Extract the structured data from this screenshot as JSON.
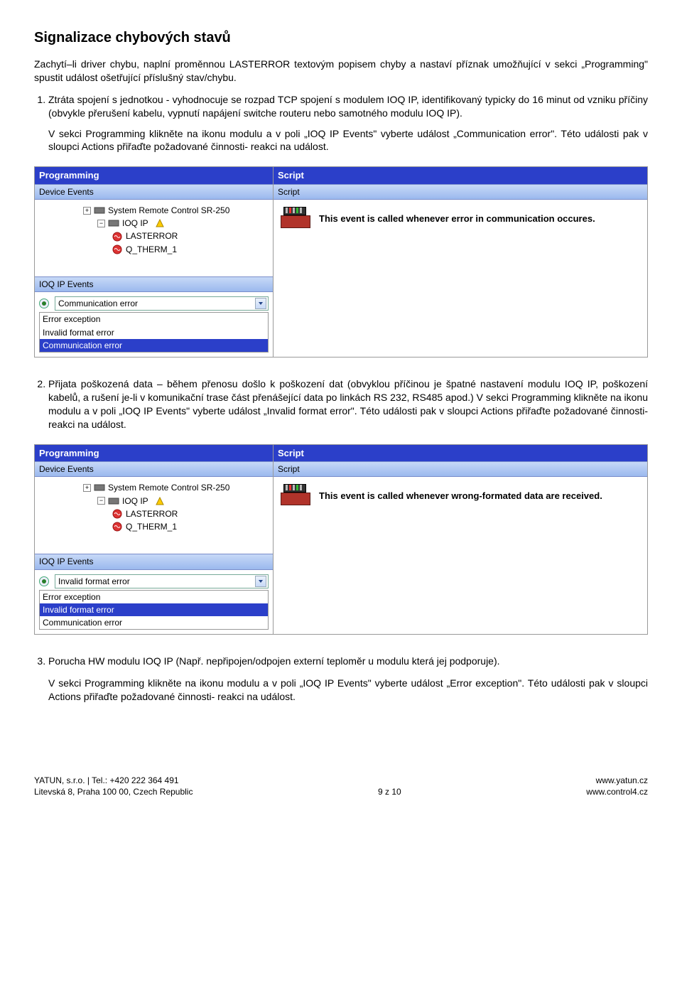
{
  "heading": "Signalizace chybových stavů",
  "intro": "Zachytí–li driver chybu, naplní proměnnou LASTERROR textovým popisem chyby a nastaví příznak umožňující v sekci „Programming\" spustit událost ošetřující příslušný stav/chybu.",
  "item1": {
    "p1": "Ztráta spojení s jednotkou - vyhodnocuje se rozpad TCP spojení s modulem IOQ IP, identifikovaný typicky do 16 minut od vzniku příčiny (obvykle přerušení kabelu, vypnutí napájení switche routeru nebo samotného modulu IOQ IP).",
    "p2": "V sekci Programming klikněte na ikonu modulu a v poli „IOQ IP Events\" vyberte událost „Communication error\". Této události pak v sloupci Actions přiřaďte požadované činnosti- reakci na událost."
  },
  "item2": "Přijata poškozená data – během přenosu došlo k poškození dat (obvyklou příčinou je špatné nastavení modulu IOQ IP, poškození kabelů, a rušení je-li v komunikační trase část přenášející data po linkách RS 232, RS485 apod.) V sekci Programming klikněte na ikonu modulu a v poli „IOQ IP Events\" vyberte událost „Invalid format error\". Této události pak v sloupci Actions přiřaďte požadované činnosti- reakci na událost.",
  "item3": {
    "p1": "Porucha HW modulu IOQ IP (Např. nepřipojen/odpojen externí teploměr u modulu která jej podporuje).",
    "p2": "V sekci Programming klikněte na ikonu modulu a v poli „IOQ IP Events\" vyberte událost „Error exception\". Této události pak v sloupci Actions přiřaďte požadované činnosti- reakci na událost."
  },
  "panels": {
    "programming": "Programming",
    "script": "Script",
    "device_events": "Device Events",
    "script_sub": "Script",
    "ioq_events": "IOQ IP Events",
    "tree": {
      "sr250": "System Remote Control SR-250",
      "ioqip": "IOQ IP",
      "lasterror": "LASTERROR",
      "qtherm": "Q_THERM_1"
    }
  },
  "shot1": {
    "selected": "Communication error",
    "options": [
      "Error exception",
      "Invalid format error",
      "Communication error"
    ],
    "sel_index": 2,
    "script_msg": "This event is called whenever error in communication occures."
  },
  "shot2": {
    "selected": "Invalid format error",
    "options": [
      "Error exception",
      "Invalid format error",
      "Communication error"
    ],
    "sel_index": 1,
    "script_msg": "This event is called whenever wrong-formated data are received."
  },
  "footer": {
    "left1": "YATUN, s.r.o. | Tel.: +420 222 364 491",
    "left2": "Litevská 8, Praha 100 00, Czech Republic",
    "mid": "9 z 10",
    "right1": "www.yatun.cz",
    "right2": "www.control4.cz"
  }
}
